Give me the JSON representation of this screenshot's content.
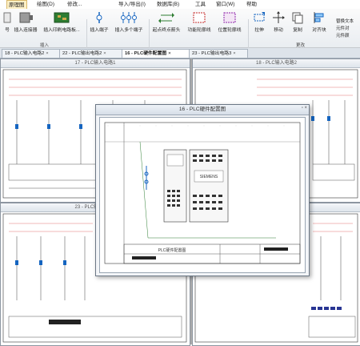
{
  "menu": {
    "items": [
      "原理图",
      "绘图(D)",
      "修改...",
      "导入/导出(I)",
      "数据库(B)",
      "工具",
      "窗口(W)",
      "帮助"
    ],
    "active_index": 0
  },
  "ribbon": {
    "buttons": [
      "号",
      "插入连接器",
      "插入印刷电路板...",
      "插入端子",
      "插入多个端子",
      "起点终点箭头",
      "功能轮廓线",
      "位置轮廓线",
      "拉伸",
      "移动",
      "复制",
      "对齐块"
    ],
    "groups": [
      "插入",
      "更改"
    ],
    "side_labels": [
      "替换文本",
      "元件对",
      "元件颜"
    ]
  },
  "tabs": [
    {
      "label": "18 - PLC输入电路2"
    },
    {
      "label": "22 - PLC输出电路2"
    },
    {
      "label": "16 - PLC硬件配置图"
    },
    {
      "label": "23 - PLC输出电路3"
    }
  ],
  "windows": {
    "input1": "17 - PLC输入电路1",
    "input2": "18 - PLC输入电路2",
    "output3": "23 - PLC输出电路3",
    "output2": "出电路2",
    "hardware": "16 - PLC硬件配置图"
  },
  "drawing": {
    "plc_brand": "SIEMENS",
    "title_block": "PLC硬件配置图"
  }
}
